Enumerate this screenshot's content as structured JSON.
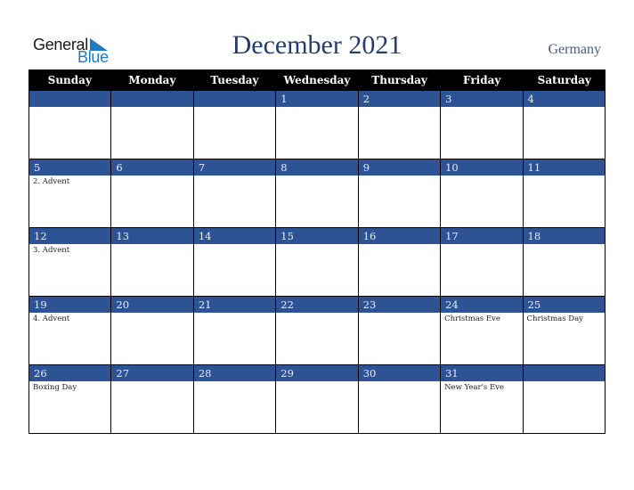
{
  "logo": {
    "line1": "General",
    "line2": "Blue"
  },
  "title": "December 2021",
  "country": "Germany",
  "days_of_week": [
    "Sunday",
    "Monday",
    "Tuesday",
    "Wednesday",
    "Thursday",
    "Friday",
    "Saturday"
  ],
  "weeks": [
    [
      {
        "day": "",
        "event": ""
      },
      {
        "day": "",
        "event": ""
      },
      {
        "day": "",
        "event": ""
      },
      {
        "day": "1",
        "event": ""
      },
      {
        "day": "2",
        "event": ""
      },
      {
        "day": "3",
        "event": ""
      },
      {
        "day": "4",
        "event": ""
      }
    ],
    [
      {
        "day": "5",
        "event": "2. Advent"
      },
      {
        "day": "6",
        "event": ""
      },
      {
        "day": "7",
        "event": ""
      },
      {
        "day": "8",
        "event": ""
      },
      {
        "day": "9",
        "event": ""
      },
      {
        "day": "10",
        "event": ""
      },
      {
        "day": "11",
        "event": ""
      }
    ],
    [
      {
        "day": "12",
        "event": "3. Advent"
      },
      {
        "day": "13",
        "event": ""
      },
      {
        "day": "14",
        "event": ""
      },
      {
        "day": "15",
        "event": ""
      },
      {
        "day": "16",
        "event": ""
      },
      {
        "day": "17",
        "event": ""
      },
      {
        "day": "18",
        "event": ""
      }
    ],
    [
      {
        "day": "19",
        "event": "4. Advent"
      },
      {
        "day": "20",
        "event": ""
      },
      {
        "day": "21",
        "event": ""
      },
      {
        "day": "22",
        "event": ""
      },
      {
        "day": "23",
        "event": ""
      },
      {
        "day": "24",
        "event": "Christmas Eve"
      },
      {
        "day": "25",
        "event": "Christmas Day"
      }
    ],
    [
      {
        "day": "26",
        "event": "Boxing Day"
      },
      {
        "day": "27",
        "event": ""
      },
      {
        "day": "28",
        "event": ""
      },
      {
        "day": "29",
        "event": ""
      },
      {
        "day": "30",
        "event": ""
      },
      {
        "day": "31",
        "event": "New Year's Eve"
      },
      {
        "day": "",
        "event": ""
      }
    ]
  ],
  "colors": {
    "header_bg": "#000000",
    "band_bg": "#2e5395",
    "title": "#253d6b",
    "logo_blue": "#1f7ac2"
  }
}
